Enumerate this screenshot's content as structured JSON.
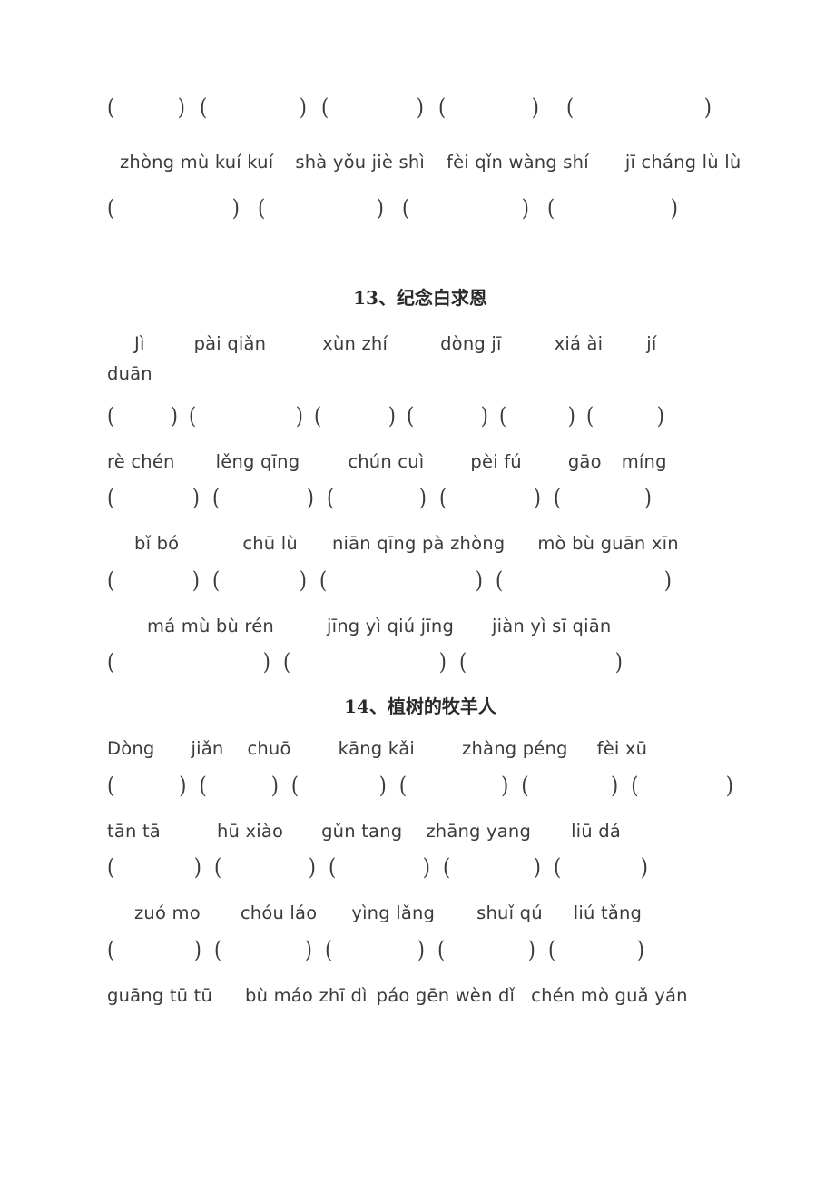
{
  "document": {
    "type": "chinese-pinyin-worksheet",
    "page_background": "#ffffff",
    "text_color": "#3b3b3b"
  },
  "blocks": {
    "top_section": {
      "bracket_row_1": [
        "(          )",
        "(          )",
        "(          )",
        "(          )",
        "(              )"
      ],
      "pinyin_row_1": [
        "zhòng mù kuí kuí",
        "shà yǒu jiè shì",
        "fèi qǐn wàng shí",
        "jī cháng lù lù"
      ],
      "bracket_row_2": [
        "(              )",
        "(              )",
        "(              )",
        "(              )"
      ]
    },
    "lesson_13": {
      "title": "13、纪念白求恩",
      "pinyin_row_1": [
        "Jì",
        "pài qiǎn",
        "xùn zhí",
        "dòng jī",
        "xiá ài",
        "jí"
      ],
      "pinyin_row_1_wrap": "duān",
      "bracket_row_1": [
        "(      )",
        "(          )",
        "(        )",
        "(        )",
        "(        )",
        "(        )"
      ],
      "pinyin_row_2": [
        "rè chén",
        "lěng qīng",
        "chún cuì",
        "pèi fú",
        "gāo",
        "míng"
      ],
      "bracket_row_2": [
        "(          )",
        "(          )",
        "(          )",
        "(          )",
        "(          )"
      ],
      "pinyin_row_3": [
        "bǐ bó",
        "chū lù",
        "niān qīng pà zhòng",
        "mò bù guān xīn"
      ],
      "bracket_row_3": [
        "(          )",
        "(          )",
        "(                )",
        "(                )"
      ],
      "pinyin_row_4": [
        "má mù bù rén",
        "jīng yì qiú jīng",
        "jiàn yì sī qiān"
      ],
      "bracket_row_4": [
        "(                )",
        "(                )",
        "(                )"
      ]
    },
    "lesson_14": {
      "title": "14、植树的牧羊人",
      "pinyin_row_1": [
        "Dòng",
        "jiǎn",
        "chuō",
        "kāng kǎi",
        "zhàng péng",
        "fèi xū"
      ],
      "bracket_row_1": [
        "(        )",
        "(        )",
        "(        )",
        "(        )",
        "(        )",
        "(        )"
      ],
      "pinyin_row_2": [
        "tān tā",
        "hū xiào",
        "gǔn tang",
        "zhāng yang",
        "liū dá"
      ],
      "bracket_row_2": [
        "(          )",
        "(          )",
        "(          )",
        "(          )",
        "(          )"
      ],
      "pinyin_row_3": [
        "zuó mo",
        "chóu láo",
        "yìng lǎng",
        "shuǐ qú",
        "liú tǎng"
      ],
      "bracket_row_3": [
        "(          )",
        "(          )",
        "(          )",
        "(          )",
        "(          )"
      ],
      "pinyin_row_4": [
        "guāng tū tū",
        "bù máo zhī dì",
        "páo gēn wèn dǐ",
        "chén mò guǎ yán"
      ]
    }
  },
  "brackets": {
    "left": "(",
    "right": ")"
  }
}
